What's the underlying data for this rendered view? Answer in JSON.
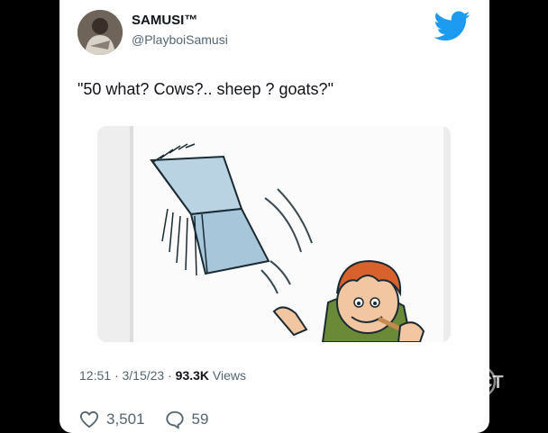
{
  "author": {
    "display_name": "SAMUSI™",
    "handle": "@PlayboiSamusi"
  },
  "tweet": {
    "text": "\"50 what? Cows?.. sheep ? goats?\"",
    "time": "12:51",
    "date": "3/15/23",
    "views_count": "93.3K",
    "views_label": "Views",
    "likes": "3,501",
    "replies": "59"
  },
  "watermark": {
    "text": "ACT"
  },
  "colors": {
    "twitter_blue": "#1d9bf0",
    "text_primary": "#0f1419",
    "text_secondary": "#536471"
  }
}
